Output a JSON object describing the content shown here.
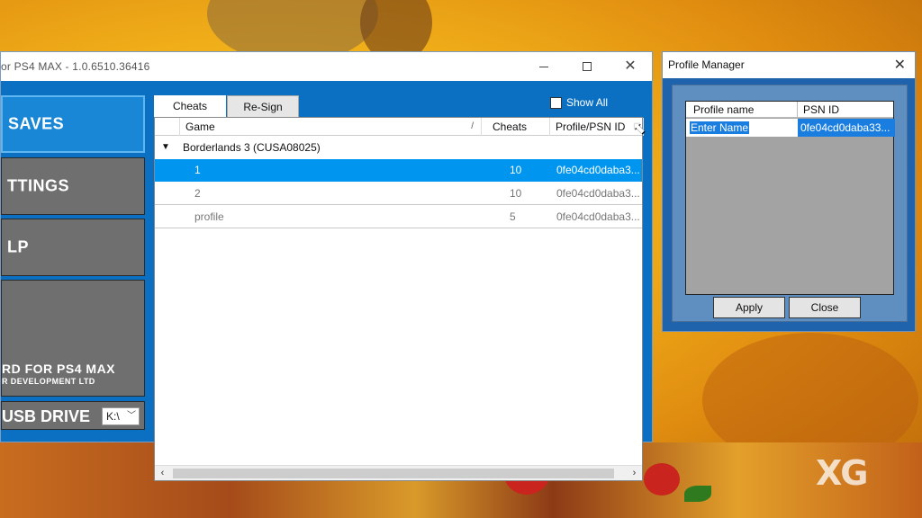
{
  "app": {
    "title": "or PS4 MAX - 1.0.6510.36416",
    "sidebar": {
      "saves_label": "SAVES",
      "settings_label": "TTINGS",
      "help_label": "LP",
      "about_title": "RD FOR PS4 MAX",
      "about_subtitle": "R DEVELOPMENT LTD",
      "usb_label": "USB DRIVE",
      "usb_value": "K:\\"
    },
    "tabs": [
      {
        "label": "Cheats",
        "active": true
      },
      {
        "label": "Re-Sign",
        "active": false
      }
    ],
    "show_all_label": "Show All",
    "list": {
      "columns": [
        "Game",
        "Cheats",
        "Profile/PSN ID"
      ],
      "group": "Borderlands 3 (CUSA08025)",
      "rows": [
        {
          "name": "1",
          "cheats": "10",
          "psn": "0fe04cd0daba3...",
          "selected": true
        },
        {
          "name": "2",
          "cheats": "10",
          "psn": "0fe04cd0daba3...",
          "selected": false
        },
        {
          "name": "profile",
          "cheats": "5",
          "psn": "0fe04cd0daba3...",
          "selected": false
        }
      ]
    }
  },
  "profile_manager": {
    "title": "Profile Manager",
    "columns": [
      "Profile name",
      "PSN ID"
    ],
    "row": {
      "name": "Enter Name",
      "psn": "0fe04cd0daba33..."
    },
    "apply_label": "Apply",
    "close_label": "Close"
  },
  "watermark": "XG",
  "colors": {
    "window_blue": "#0b6fc2",
    "selected_row": "#0096f0",
    "sidebar_active": "#1a86d6",
    "sidebar_inactive": "#6f6f6f"
  }
}
